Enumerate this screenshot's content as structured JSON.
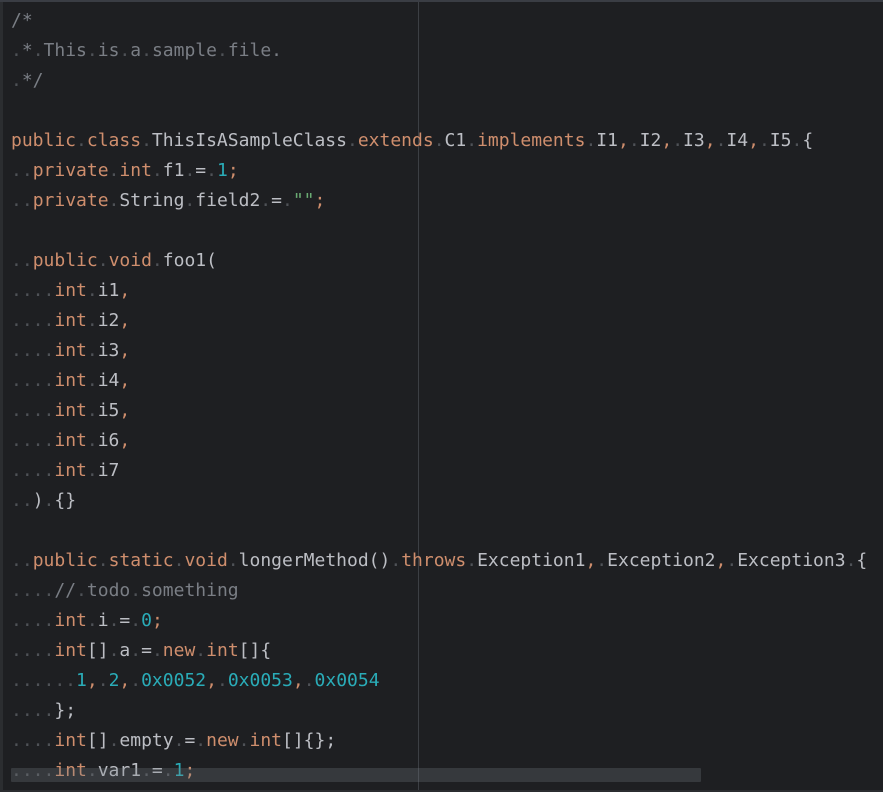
{
  "editor": {
    "language": "java",
    "colors": {
      "background": "#1e1f22",
      "keyword": "#cf8e6d",
      "comment": "#7a7e85",
      "number": "#2aacb8",
      "string": "#6aab73",
      "identifier": "#bcbec4",
      "whitespace_marker": "#4f5257"
    },
    "lines": [
      [
        [
          "cm",
          "/*"
        ]
      ],
      [
        [
          "ws",
          "."
        ],
        [
          "cm",
          "*"
        ],
        [
          "ws",
          "."
        ],
        [
          "cm",
          "This"
        ],
        [
          "ws",
          "."
        ],
        [
          "cm",
          "is"
        ],
        [
          "ws",
          "."
        ],
        [
          "cm",
          "a"
        ],
        [
          "ws",
          "."
        ],
        [
          "cm",
          "sample"
        ],
        [
          "ws",
          "."
        ],
        [
          "cm",
          "file."
        ]
      ],
      [
        [
          "ws",
          "."
        ],
        [
          "cm",
          "*/"
        ]
      ],
      [],
      [
        [
          "kw",
          "public"
        ],
        [
          "ws",
          "."
        ],
        [
          "kw",
          "class"
        ],
        [
          "ws",
          "."
        ],
        [
          "id",
          "ThisIsASampleClass"
        ],
        [
          "ws",
          "."
        ],
        [
          "kw",
          "extends"
        ],
        [
          "ws",
          "."
        ],
        [
          "id",
          "C1"
        ],
        [
          "ws",
          "."
        ],
        [
          "kw",
          "implements"
        ],
        [
          "ws",
          "."
        ],
        [
          "id",
          "I1"
        ],
        [
          "comma",
          ","
        ],
        [
          "ws",
          "."
        ],
        [
          "id",
          "I2"
        ],
        [
          "comma",
          ","
        ],
        [
          "ws",
          "."
        ],
        [
          "id",
          "I3"
        ],
        [
          "comma",
          ","
        ],
        [
          "ws",
          "."
        ],
        [
          "id",
          "I4"
        ],
        [
          "comma",
          ","
        ],
        [
          "ws",
          "."
        ],
        [
          "id",
          "I5"
        ],
        [
          "ws",
          "."
        ],
        [
          "pn",
          "{"
        ]
      ],
      [
        [
          "ws",
          ".."
        ],
        [
          "kw",
          "private"
        ],
        [
          "ws",
          "."
        ],
        [
          "kw",
          "int"
        ],
        [
          "ws",
          "."
        ],
        [
          "id",
          "f1"
        ],
        [
          "ws",
          "."
        ],
        [
          "pn",
          "="
        ],
        [
          "ws",
          "."
        ],
        [
          "num",
          "1"
        ],
        [
          "comma",
          ";"
        ]
      ],
      [
        [
          "ws",
          ".."
        ],
        [
          "kw",
          "private"
        ],
        [
          "ws",
          "."
        ],
        [
          "id",
          "String"
        ],
        [
          "ws",
          "."
        ],
        [
          "id",
          "field2"
        ],
        [
          "ws",
          "."
        ],
        [
          "pn",
          "="
        ],
        [
          "ws",
          "."
        ],
        [
          "str",
          "\"\""
        ],
        [
          "comma",
          ";"
        ]
      ],
      [],
      [
        [
          "ws",
          ".."
        ],
        [
          "kw",
          "public"
        ],
        [
          "ws",
          "."
        ],
        [
          "kw",
          "void"
        ],
        [
          "ws",
          "."
        ],
        [
          "id",
          "foo1("
        ]
      ],
      [
        [
          "ws",
          "...."
        ],
        [
          "kw",
          "int"
        ],
        [
          "ws",
          "."
        ],
        [
          "id",
          "i1"
        ],
        [
          "comma",
          ","
        ]
      ],
      [
        [
          "ws",
          "...."
        ],
        [
          "kw",
          "int"
        ],
        [
          "ws",
          "."
        ],
        [
          "id",
          "i2"
        ],
        [
          "comma",
          ","
        ]
      ],
      [
        [
          "ws",
          "...."
        ],
        [
          "kw",
          "int"
        ],
        [
          "ws",
          "."
        ],
        [
          "id",
          "i3"
        ],
        [
          "comma",
          ","
        ]
      ],
      [
        [
          "ws",
          "...."
        ],
        [
          "kw",
          "int"
        ],
        [
          "ws",
          "."
        ],
        [
          "id",
          "i4"
        ],
        [
          "comma",
          ","
        ]
      ],
      [
        [
          "ws",
          "...."
        ],
        [
          "kw",
          "int"
        ],
        [
          "ws",
          "."
        ],
        [
          "id",
          "i5"
        ],
        [
          "comma",
          ","
        ]
      ],
      [
        [
          "ws",
          "...."
        ],
        [
          "kw",
          "int"
        ],
        [
          "ws",
          "."
        ],
        [
          "id",
          "i6"
        ],
        [
          "comma",
          ","
        ]
      ],
      [
        [
          "ws",
          "...."
        ],
        [
          "kw",
          "int"
        ],
        [
          "ws",
          "."
        ],
        [
          "id",
          "i7"
        ]
      ],
      [
        [
          "ws",
          ".."
        ],
        [
          "pn",
          ")"
        ],
        [
          "ws",
          "."
        ],
        [
          "pn",
          "{}"
        ]
      ],
      [],
      [
        [
          "ws",
          ".."
        ],
        [
          "kw",
          "public"
        ],
        [
          "ws",
          "."
        ],
        [
          "kw",
          "static"
        ],
        [
          "ws",
          "."
        ],
        [
          "kw",
          "void"
        ],
        [
          "ws",
          "."
        ],
        [
          "id",
          "longerMethod()"
        ],
        [
          "ws",
          "."
        ],
        [
          "kw",
          "throws"
        ],
        [
          "ws",
          "."
        ],
        [
          "id",
          "Exception1"
        ],
        [
          "comma",
          ","
        ],
        [
          "ws",
          "."
        ],
        [
          "id",
          "Exception2"
        ],
        [
          "comma",
          ","
        ],
        [
          "ws",
          "."
        ],
        [
          "id",
          "Exception3"
        ],
        [
          "ws",
          "."
        ],
        [
          "pn",
          "{"
        ]
      ],
      [
        [
          "ws",
          "...."
        ],
        [
          "cm",
          "//"
        ],
        [
          "ws",
          "."
        ],
        [
          "cm",
          "todo"
        ],
        [
          "ws",
          "."
        ],
        [
          "cm",
          "something"
        ]
      ],
      [
        [
          "ws",
          "...."
        ],
        [
          "kw",
          "int"
        ],
        [
          "ws",
          "."
        ],
        [
          "id",
          "i"
        ],
        [
          "ws",
          "."
        ],
        [
          "pn",
          "="
        ],
        [
          "ws",
          "."
        ],
        [
          "num",
          "0"
        ],
        [
          "comma",
          ";"
        ]
      ],
      [
        [
          "ws",
          "...."
        ],
        [
          "kw",
          "int"
        ],
        [
          "pn",
          "[]"
        ],
        [
          "ws",
          "."
        ],
        [
          "id",
          "a"
        ],
        [
          "ws",
          "."
        ],
        [
          "pn",
          "="
        ],
        [
          "ws",
          "."
        ],
        [
          "kw",
          "new"
        ],
        [
          "ws",
          "."
        ],
        [
          "kw",
          "int"
        ],
        [
          "pn",
          "[]{"
        ]
      ],
      [
        [
          "ws",
          "......"
        ],
        [
          "num",
          "1"
        ],
        [
          "comma",
          ","
        ],
        [
          "ws",
          "."
        ],
        [
          "num",
          "2"
        ],
        [
          "comma",
          ","
        ],
        [
          "ws",
          "."
        ],
        [
          "num",
          "0x0052"
        ],
        [
          "comma",
          ","
        ],
        [
          "ws",
          "."
        ],
        [
          "num",
          "0x0053"
        ],
        [
          "comma",
          ","
        ],
        [
          "ws",
          "."
        ],
        [
          "num",
          "0x0054"
        ]
      ],
      [
        [
          "ws",
          "...."
        ],
        [
          "pn",
          "};"
        ]
      ],
      [
        [
          "ws",
          "...."
        ],
        [
          "kw",
          "int"
        ],
        [
          "pn",
          "[]"
        ],
        [
          "ws",
          "."
        ],
        [
          "id",
          "empty"
        ],
        [
          "ws",
          "."
        ],
        [
          "pn",
          "="
        ],
        [
          "ws",
          "."
        ],
        [
          "kw",
          "new"
        ],
        [
          "ws",
          "."
        ],
        [
          "kw",
          "int"
        ],
        [
          "pn",
          "[]{};"
        ]
      ],
      [
        [
          "ws",
          "...."
        ],
        [
          "kw",
          "int"
        ],
        [
          "ws",
          "."
        ],
        [
          "id",
          "var1"
        ],
        [
          "ws",
          "."
        ],
        [
          "pn",
          "="
        ],
        [
          "ws",
          "."
        ],
        [
          "num",
          "1"
        ],
        [
          "comma",
          ";"
        ]
      ]
    ]
  }
}
